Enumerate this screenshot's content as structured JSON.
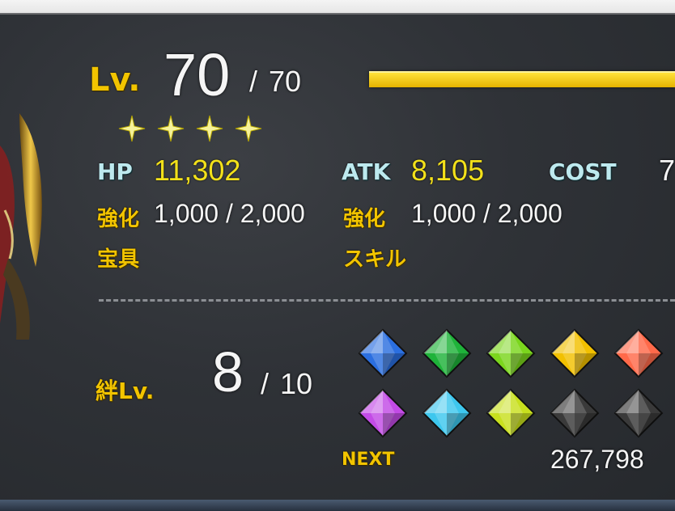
{
  "level": {
    "label": "Lv.",
    "current": "70",
    "separator": "/",
    "max": "70",
    "exp_fill": 1.0
  },
  "rarity_stars": 4,
  "stats": {
    "hp_label": "HP",
    "hp_value": "11,302",
    "atk_label": "ATK",
    "atk_value": "8,105",
    "cost_label": "COST",
    "cost_value": "7",
    "enhance_label_1": "強化",
    "enhance_value_1": "1,000 / 2,000",
    "enhance_label_2": "強化",
    "enhance_value_2": "1,000 / 2,000",
    "np_label": "宝具",
    "skill_label": "スキル"
  },
  "bond": {
    "label": "絆Lv.",
    "current": "8",
    "separator": "/",
    "max": "10",
    "next_label": "NEXT",
    "next_value": "267,798",
    "gem_colors": [
      "#2b6fe0",
      "#1fb33a",
      "#7bd61d",
      "#f2c000",
      "#ff6a4a",
      "#c34be6",
      "#3ec7ee",
      "#c8e01e",
      "#3a3a3a",
      "#3a3a3a"
    ]
  },
  "colors": {
    "gold": "#f2c400",
    "teal": "#bde9ee",
    "exp_bar": "#f5cd10"
  }
}
